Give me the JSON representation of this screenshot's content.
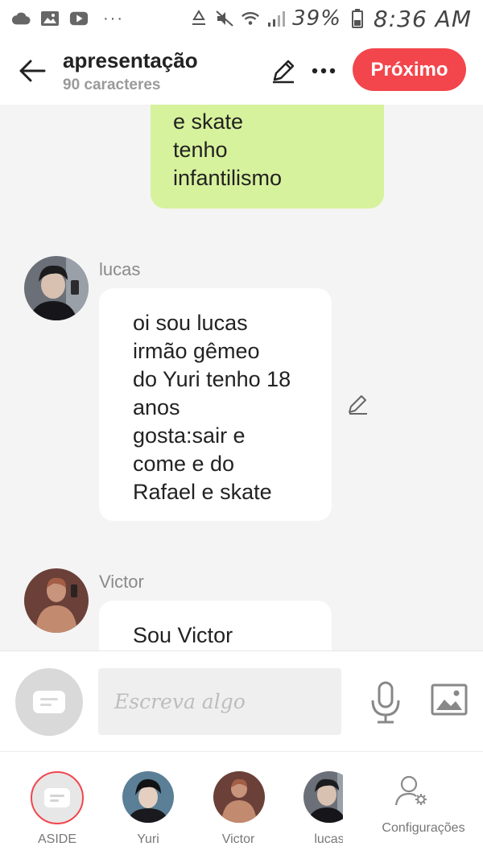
{
  "status_bar": {
    "battery_percent": "39%",
    "time": "8:36 AM",
    "left_icons": [
      "cloud-icon",
      "image-icon",
      "youtube-icon"
    ],
    "more": "···"
  },
  "header": {
    "title": "apresentação",
    "subtitle": "90 caracteres",
    "next_label": "Próximo",
    "accent_color": "#f2464c"
  },
  "messages": [
    {
      "sender": "",
      "lines": [
        "e skate",
        "tenho",
        "infantilismo"
      ],
      "bubble_color": "#d7f29c"
    },
    {
      "sender": "lucas",
      "lines": [
        "oi sou lucas",
        "irmão gêmeo",
        "do Yuri tenho 18",
        "anos",
        "gosta:sair e",
        "come e do",
        "Rafael e skate"
      ]
    },
    {
      "sender": "Victor",
      "lines": [
        "Sou Victor"
      ]
    }
  ],
  "composer": {
    "placeholder": "Escreva algo"
  },
  "bottom_bar": {
    "items": [
      {
        "label": "ASIDE"
      },
      {
        "label": "Yuri"
      },
      {
        "label": "Victor"
      },
      {
        "label": "lucas"
      },
      {
        "label": "Configurações"
      }
    ]
  }
}
